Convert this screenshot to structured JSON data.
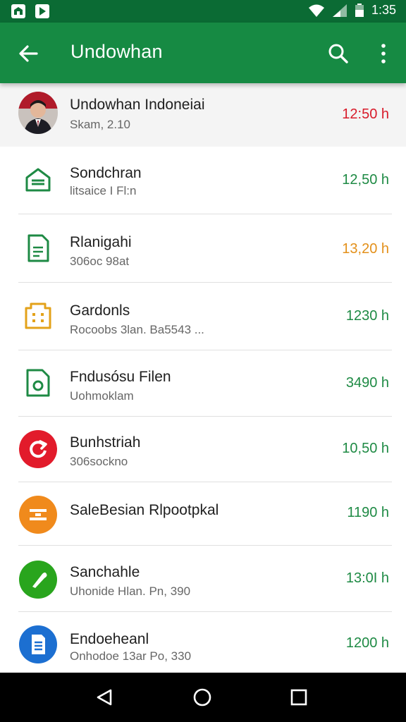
{
  "status": {
    "time": "1:35"
  },
  "appbar": {
    "title": "Undowhan"
  },
  "colors": {
    "appbar": "#168a43",
    "statusbar": "#0b6b34",
    "green": "#1e8a44",
    "red": "#d81b2a",
    "orange": "#e3901a"
  },
  "items": [
    {
      "title": "Undowhan Indoneiai",
      "subtitle": "Skam, 2.10",
      "value": "12:50 h",
      "icon": "avatar"
    },
    {
      "title": "Sondchran",
      "subtitle": "litsaice I Fl:n",
      "value": "12,50 h",
      "icon": "home-icon"
    },
    {
      "title": "Rlanigahi",
      "subtitle": "306oc 98at",
      "value": "13,20 h",
      "icon": "document-icon"
    },
    {
      "title": "Gardonls",
      "subtitle": "Rocoobs 3lan. Ba5543 ...",
      "value": "1230 h",
      "icon": "building-icon"
    },
    {
      "title": "Fndusósu Filen",
      "subtitle": "Uohmoklam",
      "value": "3490 h",
      "icon": "file-icon"
    },
    {
      "title": "Bunhstriah",
      "subtitle": "306sockno",
      "value": "10,50 h",
      "icon": "refresh-icon"
    },
    {
      "title": "SaleBesian Rlpootpkal",
      "subtitle": "",
      "value": "1190 h",
      "icon": "list-icon"
    },
    {
      "title": "Sanchahle",
      "subtitle": "Uhonide Hlan. Pn, 390",
      "value": "13:0I h",
      "icon": "pencil-icon"
    },
    {
      "title": "Endoeheanl",
      "subtitle": "Onhodoe 13ar Po, 330",
      "value": "1200 h",
      "icon": "sheet-icon"
    }
  ]
}
